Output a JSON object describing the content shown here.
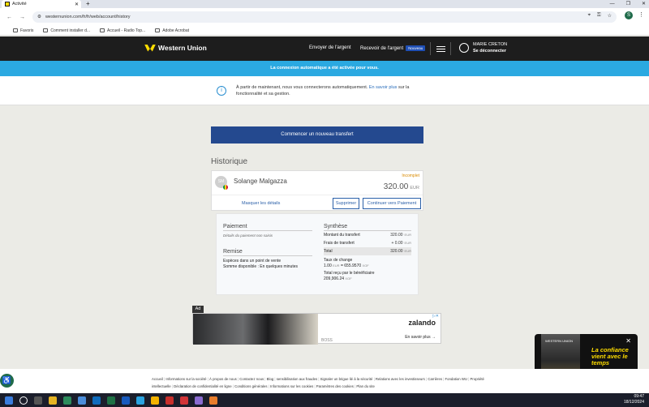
{
  "browser": {
    "tab_title": "Activité",
    "url": "westernunion.com/fr/fr/web/account/history",
    "bookmarks": [
      "Favoris",
      "Comment installer d...",
      "Accueil - Radio Top...",
      "Adobe Acrobat"
    ],
    "profile_initial": "S"
  },
  "header": {
    "brand": "Western Union",
    "send_money": "Envoyer de l'argent",
    "receive_money": "Recevoir de l'argent",
    "new_badge": "Nouveau",
    "user_name": "MARIE CRETON",
    "logout": "Se déconnecter"
  },
  "banner": {
    "text": "La connexion automatique a été activée pour vous."
  },
  "info": {
    "text_before": "À partir de maintenant, nous vous connecterons automatiquement.",
    "link": "En savoir plus",
    "text_after": "sur la fonctionnalité et sa gestion."
  },
  "cta": {
    "label": "Commencer un nouveau transfert"
  },
  "history": {
    "title": "Historique",
    "transfer": {
      "initials": "SM",
      "recipient": "Solange Malgazza",
      "status": "Incomplet",
      "amount": "320.00",
      "currency": "EUR",
      "hide_details": "Masquer les détails",
      "delete_label": "Supprimer",
      "continue_label": "Continuer vers Paiement"
    }
  },
  "details": {
    "payment_title": "Paiement",
    "payment_note": "Détails du paiement non saisis",
    "remise_title": "Remise",
    "remise_method": "Espèces dans un point de vente",
    "remise_available": "Somme disponible : En quelques minutes",
    "summary_title": "Synthèse",
    "rows": [
      {
        "label": "Montant du transfert",
        "value": "320.00",
        "cur": "EUR"
      },
      {
        "label": "Frais de transfert",
        "value": "+ 0.00",
        "cur": "EUR"
      },
      {
        "label": "Total",
        "value": "320.00",
        "cur": "EUR"
      }
    ],
    "rate_label": "Taux de change",
    "rate_value": "1.00",
    "rate_eur": "EUR",
    "rate_eq": "= 655.9570",
    "rate_xof": "XOF",
    "received_label": "Total reçu par le bénéficiaire",
    "received_value": "209,906.24",
    "received_cur": "XOF"
  },
  "ad": {
    "label": "Ad",
    "brand": "zalando",
    "more": "En savoir plus →",
    "boss": "BOSS"
  },
  "popup": {
    "wu": "WESTERN UNION",
    "headline": "La confiance vient avec le temps",
    "sub": "Des transferts d'argent fiables depuis 1871"
  },
  "footer": {
    "links": [
      "Accueil",
      "Informations sur la société",
      "À propos de nous",
      "Contactez nous",
      "Blog",
      "sensibilisation aux fraudes",
      "Signaler un brigue lié à la sécurité",
      "Relations avec les investisseurs",
      "Carrières",
      "Fondation WU",
      "Propriété intellectuelle",
      "Déclaration de confidentialité en ligne",
      "Conditions générales",
      "Informations sur les cookies",
      "Paramètres des cookies",
      "Plan du site"
    ]
  },
  "taskbar": {
    "time": "09:47",
    "date": "18/12/2024"
  }
}
